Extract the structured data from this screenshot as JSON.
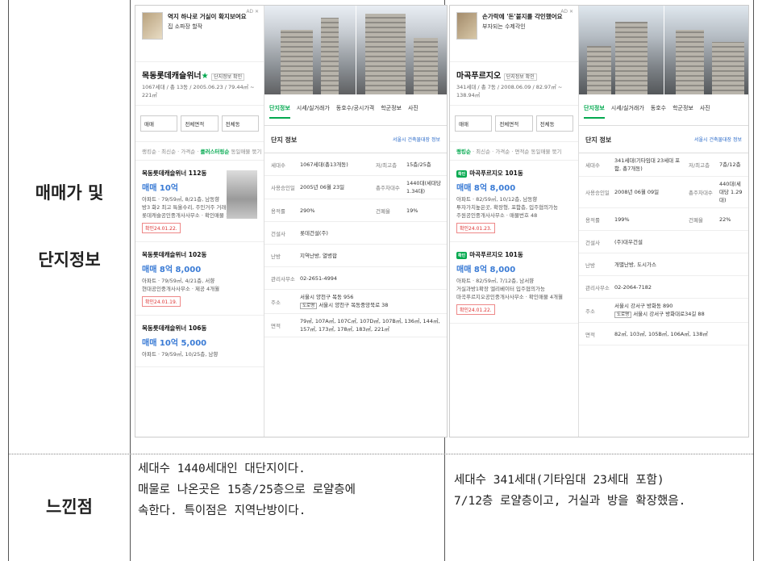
{
  "labels": {
    "row1_line1": "매매가 및",
    "row1_line2": "단지정보",
    "row2": "느낀점"
  },
  "left": {
    "ad": {
      "tag": "AD ✕",
      "title": "역지 하나로 거실이 확지보여요",
      "sub": "집 소파장 할작"
    },
    "complex": {
      "name": "목동롯데캐슬위너",
      "star": "★",
      "verify": "단지정보 확인",
      "sub": "1067세대 / 총 13동 / 2005.06.23 / 79.44㎡ ~ 221㎡"
    },
    "filters": [
      "매매",
      "전체면적",
      "전체동"
    ],
    "sort": {
      "items": [
        "랭킹순",
        "최신순",
        "가격순",
        "면적순"
      ],
      "active": "클러스터링순",
      "extra": "동일매물 묶기"
    },
    "listings": [
      {
        "title": "목동롯데캐슬위너 112동",
        "price": "매매 10억",
        "desc1": "아파트 · 79/59㎡, 8/21층, 남동향",
        "desc2": "방3 화2 최고 특올수리, 주인거주 거래중",
        "desc3": "롯데캐슬공인중개사사무소 · 확인매물 14.7",
        "date": "확인24.01.22."
      },
      {
        "title": "목동롯데캐슬위너 102동",
        "price": "매매 8억 8,000",
        "desc1": "아파트 · 79/59㎡, 4/21층, 서향",
        "desc2": "현대공인중개사사무소 · 제공 4개월",
        "desc3": "",
        "date": "확인24.01.19."
      },
      {
        "title": "목동롯데캐슬위너 106동",
        "price": "매매 10억 5,000",
        "desc1": "아파트 · 79/59㎡, 10/25층, 남향",
        "desc2": "",
        "desc3": "",
        "date": ""
      }
    ],
    "panel": {
      "tabs": [
        "단지정보",
        "시세/실거래가",
        "동호수/공시가격",
        "학군정보",
        "사진"
      ],
      "active_tab": "단지정보",
      "section": "단지 정보",
      "link": "서울시 건축물대장 정보",
      "rows": [
        {
          "k": "세대수",
          "v": "1067세대(총13개동)",
          "k2": "저/최고층",
          "v2": "15층/25층"
        },
        {
          "k": "사용승인일",
          "v": "2005년 06월 23일",
          "k2": "총주차대수",
          "v2": "1440대(세대당 1.34대)"
        },
        {
          "k": "용적률",
          "v": "290%",
          "k2": "건폐율",
          "v2": "19%"
        },
        {
          "k": "건설사",
          "v": "롯데건설(주)",
          "k2": "",
          "v2": ""
        },
        {
          "k": "난방",
          "v": "지역난방, 열병합",
          "k2": "",
          "v2": ""
        },
        {
          "k": "관리사무소",
          "v": "02-2651-4994",
          "k2": "",
          "v2": ""
        },
        {
          "k": "주소",
          "v": "서울시 양천구 목동 956",
          "v_road": "서울시 양천구 목동중앙북로 38",
          "k2": "",
          "v2": ""
        },
        {
          "k": "면적",
          "v": "79㎡, 107A㎡, 107C㎡, 107D㎡, 107B㎡, 136㎡, 144㎡, 157㎡, 173㎡, 178㎡, 183㎡, 221㎡",
          "k2": "",
          "v2": ""
        }
      ]
    }
  },
  "right": {
    "ad": {
      "tag": "AD ✕",
      "title": "손가락에 '돈'붙지를 각인했어요",
      "sub": "부자되는 수제각인"
    },
    "complex": {
      "name": "마곡푸르지오",
      "star": "",
      "verify": "단지정보 확인",
      "sub": "341세대 / 총 7동 / 2008.06.09 / 82.97㎡ ~ 138.94㎡"
    },
    "filters": [
      "매매",
      "전체면적",
      "전체동"
    ],
    "sort": {
      "items": [
        "랭킹순",
        "최신순",
        "가격순",
        "면적순"
      ],
      "active": "랭킹순",
      "extra": "동일매물 묶기"
    },
    "listings": [
      {
        "title": "마곡푸르지오 101동",
        "price": "매매 8억 8,000",
        "desc1": "아파트 · 82/59㎡, 10/12층, 남동향",
        "desc2": "투자가치높은곳, 확장형, 포함층, 입주협의가능",
        "desc3": "주원공인중개사사무소 · 매물번호 48",
        "date": "확인24.01.23."
      },
      {
        "title": "마곡푸르지오 101동",
        "price": "매매 8억 8,000",
        "desc1": "아파트 · 82/59㎡, 7/12층, 남서향",
        "desc2": "거실과방1확장 엘리베이터 입주협의가능",
        "desc3": "마곡푸르지오공인중개사사무소 · 확인매물 4개월",
        "date": "확인24.01.22."
      }
    ],
    "panel": {
      "tabs": [
        "단지정보",
        "시세/실거래가",
        "동호수",
        "학군정보",
        "사진"
      ],
      "active_tab": "단지정보",
      "section": "단지 정보",
      "link": "서울시 건축물대장 정보",
      "rows": [
        {
          "k": "세대수",
          "v": "341세대(기타임대 23세대 포함, 총7개동)",
          "k2": "저/최고층",
          "v2": "7층/12층"
        },
        {
          "k": "사용승인일",
          "v": "2008년 06월 09일",
          "k2": "총주차대수",
          "v2": "440대(세대당 1.29대)"
        },
        {
          "k": "용적률",
          "v": "199%",
          "k2": "건폐율",
          "v2": "22%"
        },
        {
          "k": "건설사",
          "v": "(주)대우건설",
          "k2": "",
          "v2": ""
        },
        {
          "k": "난방",
          "v": "개별난방, 도시가스",
          "k2": "",
          "v2": ""
        },
        {
          "k": "관리사무소",
          "v": "02-2064-7182",
          "k2": "",
          "v2": ""
        },
        {
          "k": "주소",
          "v": "서울시 강서구 방화동 890",
          "v_road": "서울시 강서구 방화대로34길 88",
          "k2": "",
          "v2": ""
        },
        {
          "k": "면적",
          "v": "82㎡, 103㎡, 105B㎡, 106A㎡, 138㎡",
          "k2": "",
          "v2": ""
        }
      ]
    }
  },
  "notes": {
    "left": [
      "세대수 1440세대인 대단지이다.",
      "매물로 나온곳은 15층/25층으로 로얄층에",
      "속한다. 특이점은 지역난방이다."
    ],
    "right": [
      "세대수 341세대(기타임대 23세대 포함)",
      "7/12층 로얄층이고, 거실과 방을 확장했음."
    ]
  }
}
